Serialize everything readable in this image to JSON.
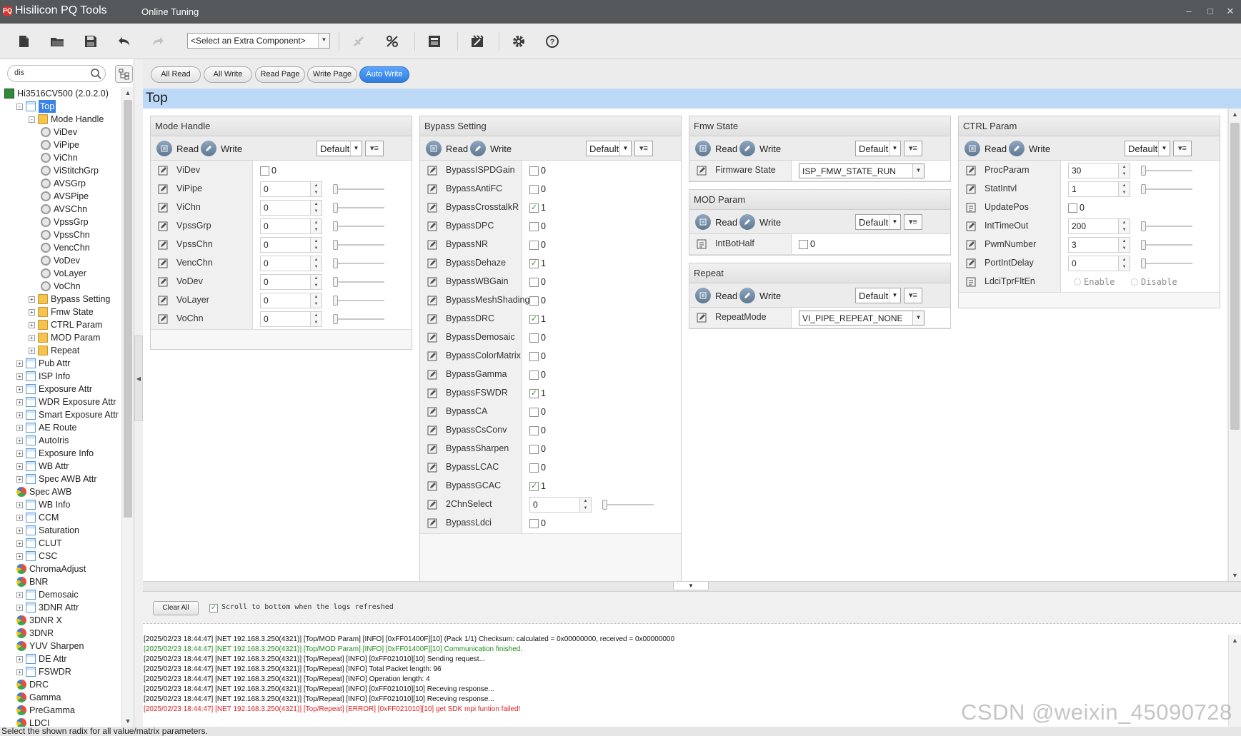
{
  "app": {
    "logo_text": "PQ",
    "title": "Hisilicon PQ Tools",
    "mode": "Online Tuning"
  },
  "toolbar": {
    "component_select": "<Select an Extra Component>",
    "icons": [
      "new-file-icon",
      "open-folder-icon",
      "save-icon",
      "undo-icon",
      "redo-icon",
      "connect-icon",
      "disconnect-icon",
      "save-page-icon",
      "tools-icon",
      "settings-icon",
      "help-icon"
    ]
  },
  "sidebar": {
    "search_value": "dis",
    "tree": [
      {
        "label": "Hi3516CV500 (2.0.2.0)",
        "icon": "chip",
        "level": 0,
        "exp": ""
      },
      {
        "label": "Top",
        "icon": "table",
        "level": 1,
        "exp": "-",
        "selected": true
      },
      {
        "label": "Mode Handle",
        "icon": "folder",
        "level": 2,
        "exp": "-"
      },
      {
        "label": "ViDev",
        "icon": "gear",
        "level": 3,
        "exp": ""
      },
      {
        "label": "ViPipe",
        "icon": "gear",
        "level": 3,
        "exp": ""
      },
      {
        "label": "ViChn",
        "icon": "gear",
        "level": 3,
        "exp": ""
      },
      {
        "label": "ViStitchGrp",
        "icon": "gear",
        "level": 3,
        "exp": ""
      },
      {
        "label": "AVSGrp",
        "icon": "gear",
        "level": 3,
        "exp": ""
      },
      {
        "label": "AVSPipe",
        "icon": "gear",
        "level": 3,
        "exp": ""
      },
      {
        "label": "AVSChn",
        "icon": "gear",
        "level": 3,
        "exp": ""
      },
      {
        "label": "VpssGrp",
        "icon": "gear",
        "level": 3,
        "exp": ""
      },
      {
        "label": "VpssChn",
        "icon": "gear",
        "level": 3,
        "exp": ""
      },
      {
        "label": "VencChn",
        "icon": "gear",
        "level": 3,
        "exp": ""
      },
      {
        "label": "VoDev",
        "icon": "gear",
        "level": 3,
        "exp": ""
      },
      {
        "label": "VoLayer",
        "icon": "gear",
        "level": 3,
        "exp": ""
      },
      {
        "label": "VoChn",
        "icon": "gear",
        "level": 3,
        "exp": ""
      },
      {
        "label": "Bypass Setting",
        "icon": "folder",
        "level": 2,
        "exp": "+"
      },
      {
        "label": "Fmw State",
        "icon": "folder",
        "level": 2,
        "exp": "+"
      },
      {
        "label": "CTRL Param",
        "icon": "folder",
        "level": 2,
        "exp": "+"
      },
      {
        "label": "MOD Param",
        "icon": "folder",
        "level": 2,
        "exp": "+"
      },
      {
        "label": "Repeat",
        "icon": "folder",
        "level": 2,
        "exp": "+"
      },
      {
        "label": "Pub Attr",
        "icon": "table",
        "level": 1,
        "exp": "+"
      },
      {
        "label": "ISP Info",
        "icon": "table",
        "level": 1,
        "exp": "+"
      },
      {
        "label": "Exposure Attr",
        "icon": "table",
        "level": 1,
        "exp": "+"
      },
      {
        "label": "WDR Exposure Attr",
        "icon": "table",
        "level": 1,
        "exp": "+"
      },
      {
        "label": "Smart Exposure Attr",
        "icon": "table",
        "level": 1,
        "exp": "+"
      },
      {
        "label": "AE Route",
        "icon": "table",
        "level": 1,
        "exp": "+"
      },
      {
        "label": "AutoIris",
        "icon": "table",
        "level": 1,
        "exp": "+"
      },
      {
        "label": "Exposure Info",
        "icon": "table",
        "level": 1,
        "exp": "+"
      },
      {
        "label": "WB Attr",
        "icon": "table",
        "level": 1,
        "exp": "+"
      },
      {
        "label": "Spec AWB Attr",
        "icon": "table",
        "level": 1,
        "exp": "+"
      },
      {
        "label": "Spec AWB",
        "icon": "chart",
        "level": 1,
        "exp": ""
      },
      {
        "label": "WB Info",
        "icon": "table",
        "level": 1,
        "exp": "+"
      },
      {
        "label": "CCM",
        "icon": "table",
        "level": 1,
        "exp": "+"
      },
      {
        "label": "Saturation",
        "icon": "table",
        "level": 1,
        "exp": "+"
      },
      {
        "label": "CLUT",
        "icon": "table",
        "level": 1,
        "exp": "+"
      },
      {
        "label": "CSC",
        "icon": "table",
        "level": 1,
        "exp": "+"
      },
      {
        "label": "ChromaAdjust",
        "icon": "chart",
        "level": 1,
        "exp": ""
      },
      {
        "label": "BNR",
        "icon": "chart",
        "level": 1,
        "exp": ""
      },
      {
        "label": "Demosaic",
        "icon": "table",
        "level": 1,
        "exp": "+"
      },
      {
        "label": "3DNR Attr",
        "icon": "table",
        "level": 1,
        "exp": "+"
      },
      {
        "label": "3DNR X",
        "icon": "chart",
        "level": 1,
        "exp": ""
      },
      {
        "label": "3DNR",
        "icon": "chart",
        "level": 1,
        "exp": ""
      },
      {
        "label": "YUV Sharpen",
        "icon": "chart",
        "level": 1,
        "exp": ""
      },
      {
        "label": "DE Attr",
        "icon": "table",
        "level": 1,
        "exp": "+"
      },
      {
        "label": "FSWDR",
        "icon": "table",
        "level": 1,
        "exp": "+"
      },
      {
        "label": "DRC",
        "icon": "chart",
        "level": 1,
        "exp": ""
      },
      {
        "label": "Gamma",
        "icon": "chart",
        "level": 1,
        "exp": ""
      },
      {
        "label": "PreGamma",
        "icon": "chart",
        "level": 1,
        "exp": ""
      },
      {
        "label": "LDCI",
        "icon": "chart",
        "level": 1,
        "exp": ""
      }
    ]
  },
  "actions": [
    "All Read",
    "All Write",
    "Read Page",
    "Write Page",
    "Auto Write"
  ],
  "page_title": "Top",
  "common": {
    "read": "Read",
    "write": "Write",
    "default": "Default"
  },
  "groups": {
    "mode_handle": {
      "title": "Mode Handle",
      "rows": [
        {
          "label": "ViDev",
          "type": "check",
          "value": "0",
          "checked": false
        },
        {
          "label": "ViPipe",
          "type": "spin",
          "value": "0"
        },
        {
          "label": "ViChn",
          "type": "spin",
          "value": "0"
        },
        {
          "label": "VpssGrp",
          "type": "spin",
          "value": "0"
        },
        {
          "label": "VpssChn",
          "type": "spin",
          "value": "0"
        },
        {
          "label": "VencChn",
          "type": "spin",
          "value": "0"
        },
        {
          "label": "VoDev",
          "type": "spin",
          "value": "0"
        },
        {
          "label": "VoLayer",
          "type": "spin",
          "value": "0"
        },
        {
          "label": "VoChn",
          "type": "spin",
          "value": "0"
        }
      ]
    },
    "bypass": {
      "title": "Bypass Setting",
      "rows": [
        {
          "label": "BypassISPDGain",
          "type": "check",
          "value": "0",
          "checked": false
        },
        {
          "label": "BypassAntiFC",
          "type": "check",
          "value": "0",
          "checked": false
        },
        {
          "label": "BypassCrosstalkR",
          "type": "check",
          "value": "1",
          "checked": true
        },
        {
          "label": "BypassDPC",
          "type": "check",
          "value": "0",
          "checked": false
        },
        {
          "label": "BypassNR",
          "type": "check",
          "value": "0",
          "checked": false
        },
        {
          "label": "BypassDehaze",
          "type": "check",
          "value": "1",
          "checked": true
        },
        {
          "label": "BypassWBGain",
          "type": "check",
          "value": "0",
          "checked": false
        },
        {
          "label": "BypassMeshShading",
          "type": "check",
          "value": "0",
          "checked": false
        },
        {
          "label": "BypassDRC",
          "type": "check",
          "value": "1",
          "checked": true
        },
        {
          "label": "BypassDemosaic",
          "type": "check",
          "value": "0",
          "checked": false
        },
        {
          "label": "BypassColorMatrix",
          "type": "check",
          "value": "0",
          "checked": false
        },
        {
          "label": "BypassGamma",
          "type": "check",
          "value": "0",
          "checked": false
        },
        {
          "label": "BypassFSWDR",
          "type": "check",
          "value": "1",
          "checked": true
        },
        {
          "label": "BypassCA",
          "type": "check",
          "value": "0",
          "checked": false
        },
        {
          "label": "BypassCsConv",
          "type": "check",
          "value": "0",
          "checked": false
        },
        {
          "label": "BypassSharpen",
          "type": "check",
          "value": "0",
          "checked": false
        },
        {
          "label": "BypassLCAC",
          "type": "check",
          "value": "0",
          "checked": false
        },
        {
          "label": "BypassGCAC",
          "type": "check",
          "value": "1",
          "checked": true
        },
        {
          "label": "2ChnSelect",
          "type": "spin",
          "value": "0"
        },
        {
          "label": "BypassLdci",
          "type": "check",
          "value": "0",
          "checked": false
        }
      ]
    },
    "fmw": {
      "title": "Fmw State",
      "rows": [
        {
          "label": "Firmware State",
          "type": "combo",
          "value": "ISP_FMW_STATE_RUN"
        }
      ]
    },
    "mod": {
      "title": "MOD Param",
      "rows": [
        {
          "label": "IntBotHalf",
          "type": "check",
          "value": "0",
          "checked": false
        }
      ]
    },
    "repeat": {
      "title": "Repeat",
      "rows": [
        {
          "label": "RepeatMode",
          "type": "combo",
          "value": "VI_PIPE_REPEAT_NONE"
        }
      ]
    },
    "ctrl": {
      "title": "CTRL Param",
      "rows": [
        {
          "label": "ProcParam",
          "type": "spin",
          "value": "30"
        },
        {
          "label": "StatIntvl",
          "type": "spin",
          "value": "1"
        },
        {
          "label": "UpdatePos",
          "type": "check",
          "value": "0",
          "checked": false
        },
        {
          "label": "IntTimeOut",
          "type": "spin",
          "value": "200"
        },
        {
          "label": "PwmNumber",
          "type": "spin",
          "value": "3"
        },
        {
          "label": "PortIntDelay",
          "type": "spin",
          "value": "0"
        },
        {
          "label": "LdciTprFltEn",
          "type": "radio",
          "options": [
            "Enable",
            "Disable"
          ]
        }
      ]
    }
  },
  "log": {
    "clear_label": "Clear All",
    "scroll_label": "Scroll to bottom when the logs refreshed",
    "lines": [
      {
        "text": "[2025/02/23 18:44:47] [NET 192.168.3.250(4321)] [Top/MOD Param] [INFO] [0xFF01400F][10] (Pack 1/1) Checksum: calculated = 0x00000000, received = 0x00000000",
        "level": "info"
      },
      {
        "text": "[2025/02/23 18:44:47] [NET 192.168.3.250(4321)] [Top/MOD Param] [INFO] [0xFF01400F][10] Communication finished.",
        "level": "ok"
      },
      {
        "text": "[2025/02/23 18:44:47] [NET 192.168.3.250(4321)] [Top/Repeat] [INFO] [0xFF021010][10] Sending request...",
        "level": "info"
      },
      {
        "text": "[2025/02/23 18:44:47] [NET 192.168.3.250(4321)] [Top/Repeat] [INFO] Total Packet length: 96",
        "level": "info"
      },
      {
        "text": "[2025/02/23 18:44:47] [NET 192.168.3.250(4321)] [Top/Repeat] [INFO] Operation length: 4",
        "level": "info"
      },
      {
        "text": "[2025/02/23 18:44:47] [NET 192.168.3.250(4321)] [Top/Repeat] [INFO] [0xFF021010][10] Receving response...",
        "level": "info"
      },
      {
        "text": "[2025/02/23 18:44:47] [NET 192.168.3.250(4321)] [Top/Repeat] [INFO] [0xFF021010][10] Receving response...",
        "level": "info"
      },
      {
        "text": "[2025/02/23 18:44:47] [NET 192.168.3.250(4321)] [Top/Repeat] [ERROR] [0xFF021010][10] get SDK mpi funtion failed!",
        "level": "err"
      }
    ]
  },
  "status_text": "Select the shown radix for all value/matrix parameters.",
  "watermark": "CSDN @weixin_45090728",
  "colors": {
    "accent": "#3b82e6",
    "page_bar": "#bcd9f7",
    "title_bar": "#55585b",
    "ok": "#1f8a1f",
    "error": "#dd2222"
  }
}
